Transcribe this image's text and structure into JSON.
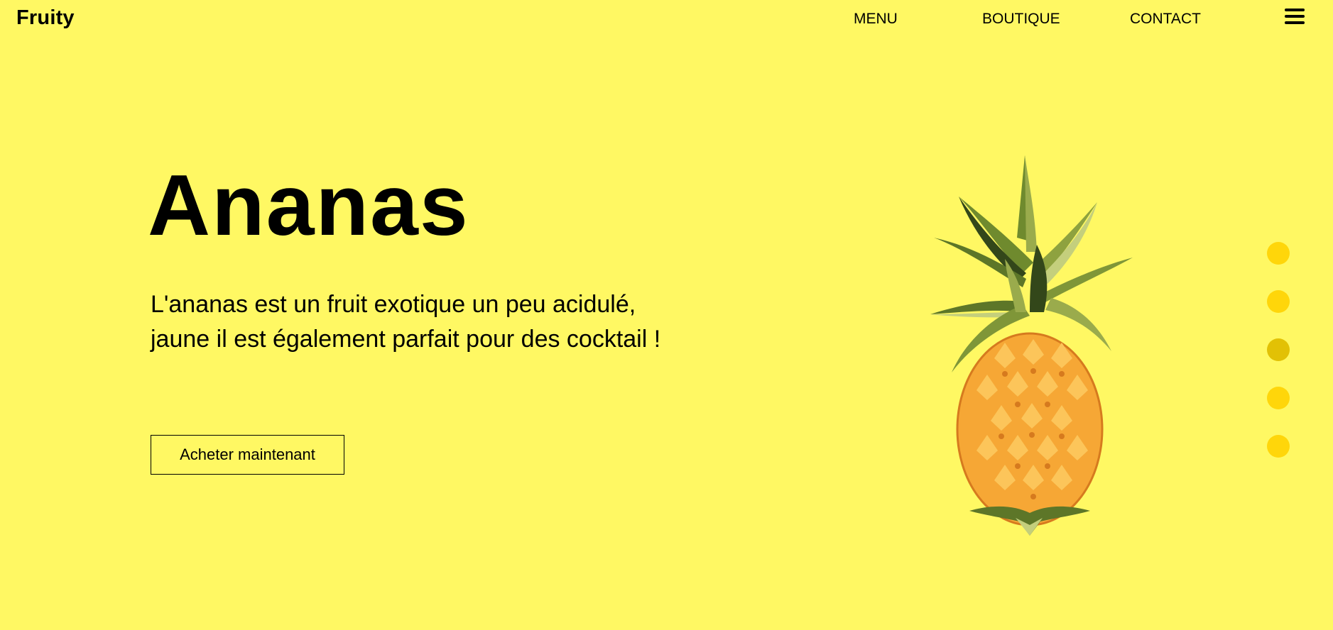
{
  "header": {
    "logo": "Fruity",
    "nav": [
      "MENU",
      "BOUTIQUE",
      "CONTACT"
    ]
  },
  "hero": {
    "title": "Ananas",
    "description": "L'ananas est un fruit exotique un peu acidulé, jaune il est également parfait pour des cocktail !",
    "cta": "Acheter maintenant",
    "image_name": "pineapple-illustration"
  },
  "slider": {
    "count": 5,
    "active_index": 2,
    "color": "#ffd60a",
    "active_color": "#e2c105"
  },
  "colors": {
    "background": "#fff863",
    "text": "#000000"
  }
}
